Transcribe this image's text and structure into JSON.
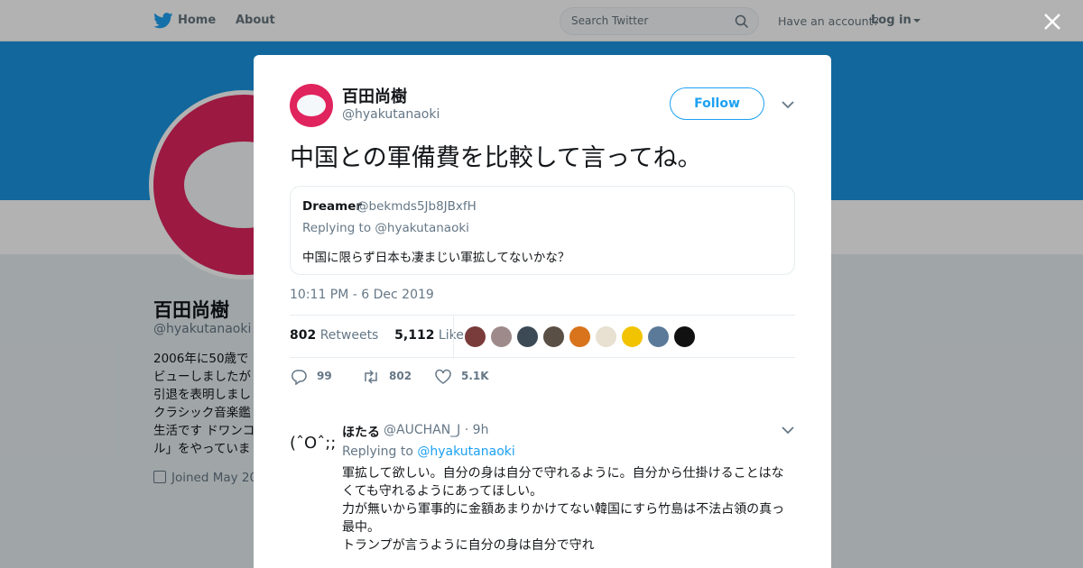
{
  "topnav": {
    "home_label": "Home",
    "about_label": "About",
    "search_placeholder": "Search Twitter",
    "have_account": "Have an account?",
    "login_label": "Log in"
  },
  "profile": {
    "name": "百田尚樹",
    "handle": "@hyakutanaoki",
    "bio": "2006年に50歳で\nビューしましたが\n引退を表明しまし\nクラシック音楽鑑\n生活です ドワンコ\nル」をやっていま",
    "joined": "Joined May 20"
  },
  "tweet": {
    "author_name": "百田尚樹",
    "author_handle": "@hyakutanaoki",
    "follow_label": "Follow",
    "text": "中国との軍備費を比較して言ってね。",
    "quote": {
      "name": "Dreamer",
      "handle": "@bekmds5Jb8JBxfH",
      "replying": "Replying to @hyakutanaoki",
      "text": "中国に限らず日本も凄まじい軍拡してないかな？"
    },
    "timestamp": "10:11 PM - 6 Dec 2019",
    "retweets_count": "802",
    "retweets_label": "Retweets",
    "likes_count": "5,112",
    "likes_label": "Likes",
    "liker_colors": [
      "#7a3b3b",
      "#9e8a8a",
      "#3c4a55",
      "#5a4f45",
      "#d9731c",
      "#e8e0d0",
      "#f2c300",
      "#5b7a99",
      "#111111"
    ],
    "reply_count": "99",
    "retweet_action_count": "802",
    "like_action_count": "5.1K"
  },
  "reply": {
    "avatar_text": "(ˆOˆ;;",
    "name": "ほたる",
    "handle": "@AUCHAN_J · 9h",
    "replying_prefix": "Replying to",
    "replying_handle": "@hyakutanaoki",
    "text": "軍拡して欲しい。自分の身は自分で守れるように。自分から仕掛けることはな\nくても守れるようにあってほしい。\n力が無いから軍事的に金額あまりかけてない韓国にすら竹島は不法占領の真っ\n最中。\nトランプが言うように自分の身は自分で守れ"
  },
  "colors": {
    "accent": "#1da1f2",
    "banner": "#1b95e0",
    "avatar_red": "#e0245e"
  }
}
